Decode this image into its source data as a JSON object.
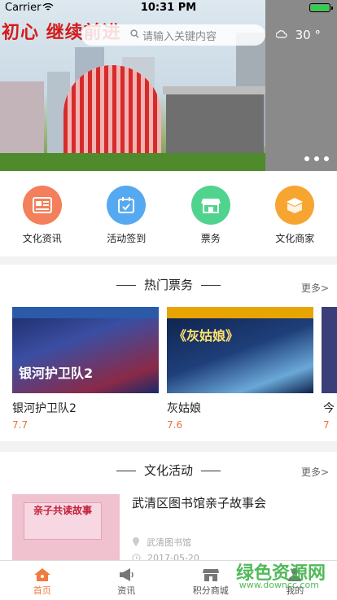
{
  "status": {
    "carrier": "Carrier",
    "time": "10:31 PM"
  },
  "banner": {
    "slogan": "初心 继续前进 ",
    "search_placeholder": "请输入关键内容",
    "weather_temp": "30 °",
    "page_dots": 3
  },
  "categories": [
    {
      "label": "文化资讯",
      "icon": "news-icon",
      "color": "#f37f5b"
    },
    {
      "label": "活动签到",
      "icon": "calendar-check-icon",
      "color": "#55a9f0"
    },
    {
      "label": "票务",
      "icon": "store-icon",
      "color": "#4fd38d"
    },
    {
      "label": "文化商家",
      "icon": "box-icon",
      "color": "#f7a531"
    }
  ],
  "tickets": {
    "title": "热门票务",
    "more": "更多>",
    "items": [
      {
        "name": "银河护卫队2",
        "rating": "7.7",
        "poster_text": "银河护卫队2"
      },
      {
        "name": "灰姑娘",
        "rating": "7.6",
        "poster_text": "《灰姑娘》"
      },
      {
        "name": "今",
        "rating": "7"
      }
    ]
  },
  "activity": {
    "title": "文化活动",
    "more": "更多>",
    "item": {
      "title": "武清区图书馆亲子故事会",
      "location": "武清图书馆",
      "date": "2017-05-20",
      "image_text": "亲子共读故事"
    }
  },
  "tabbar": [
    {
      "label": "首页",
      "icon": "home-icon",
      "active": true
    },
    {
      "label": "资讯",
      "icon": "megaphone-icon",
      "active": false
    },
    {
      "label": "积分商城",
      "icon": "shop-icon",
      "active": false
    },
    {
      "label": "我的",
      "icon": "user-icon",
      "active": false
    }
  ],
  "watermark": {
    "title": "绿色资源网",
    "url": "www.downcc.com"
  }
}
